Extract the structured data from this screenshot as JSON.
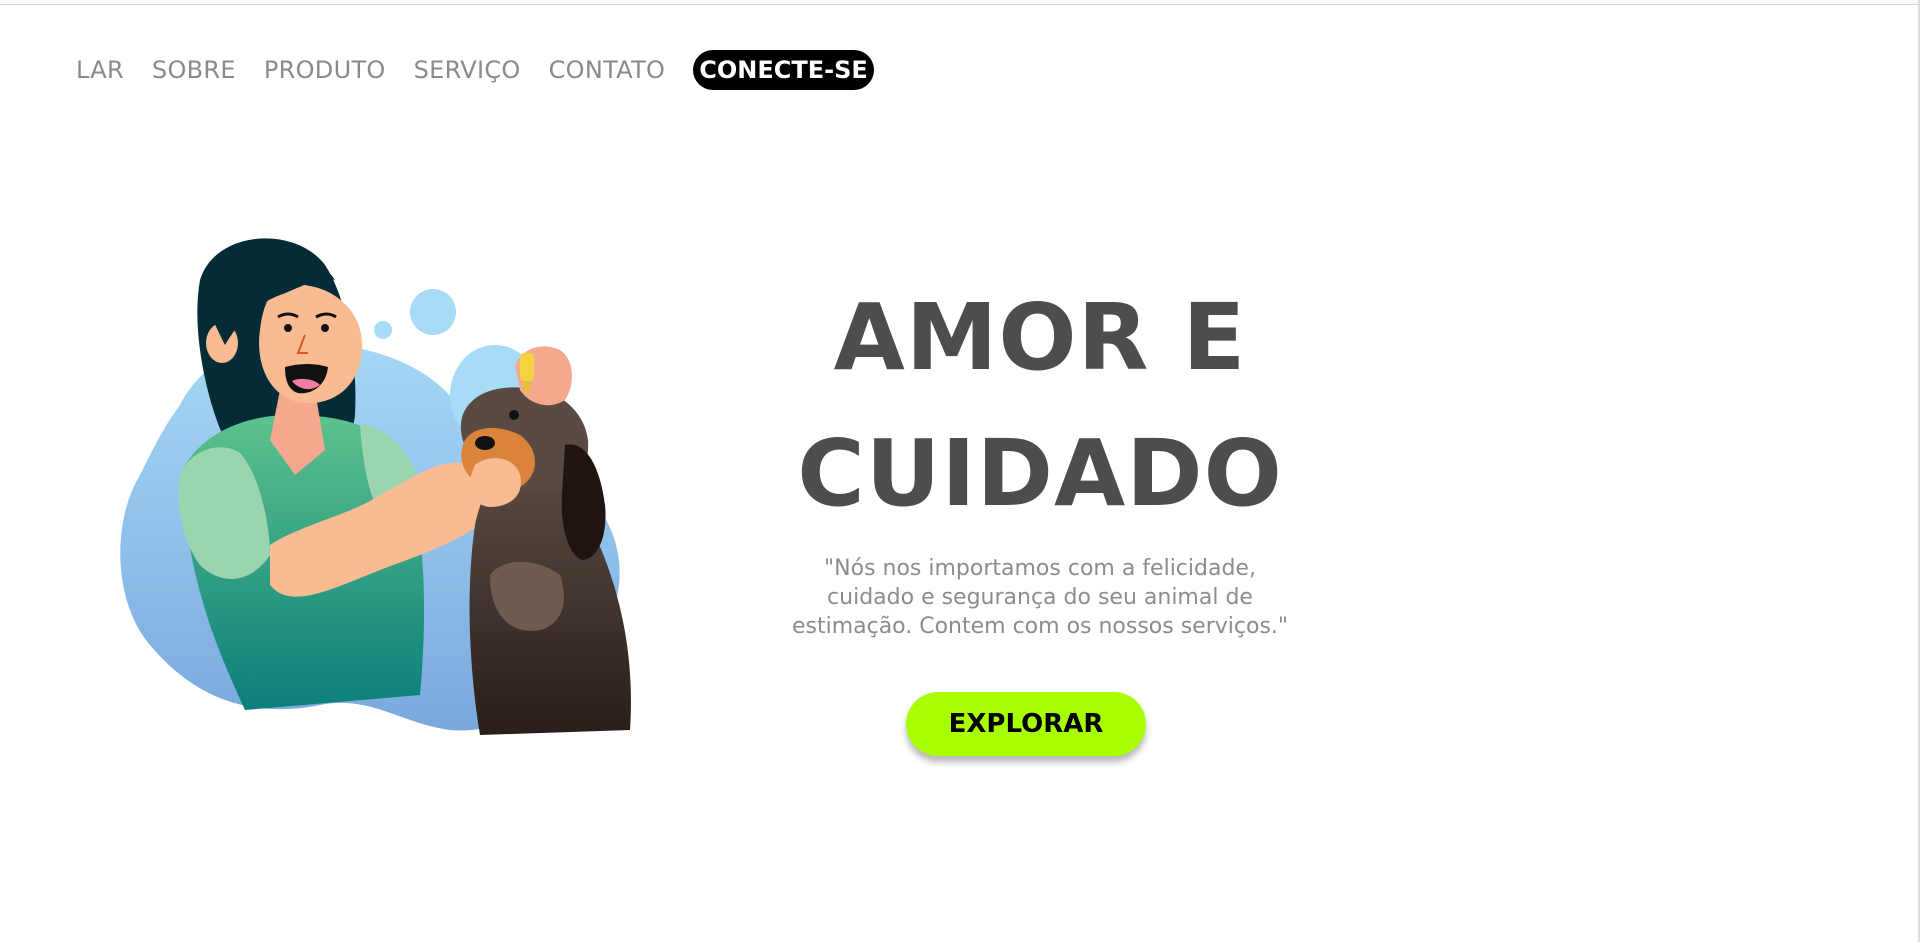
{
  "nav": {
    "items": [
      "LAR",
      "SOBRE",
      "PRODUTO",
      "SERVIÇO",
      "CONTATO"
    ],
    "cta": "CONECTE-SE"
  },
  "hero": {
    "title": "AMOR E CUIDADO",
    "description": "\"Nós nos importamos com a felicidade, cuidado e segurança do seu animal de estimação. Contem com os nossos serviços.\"",
    "button": "EXPLORAR"
  },
  "illustration": {
    "icon": "woman-caring-dog-illustration"
  },
  "colors": {
    "cta_bg": "#000000",
    "button_bg": "#a8ff00",
    "title": "#4d4d4d",
    "nav_text": "#8a8a8a",
    "body_text": "#8c8c8c"
  }
}
